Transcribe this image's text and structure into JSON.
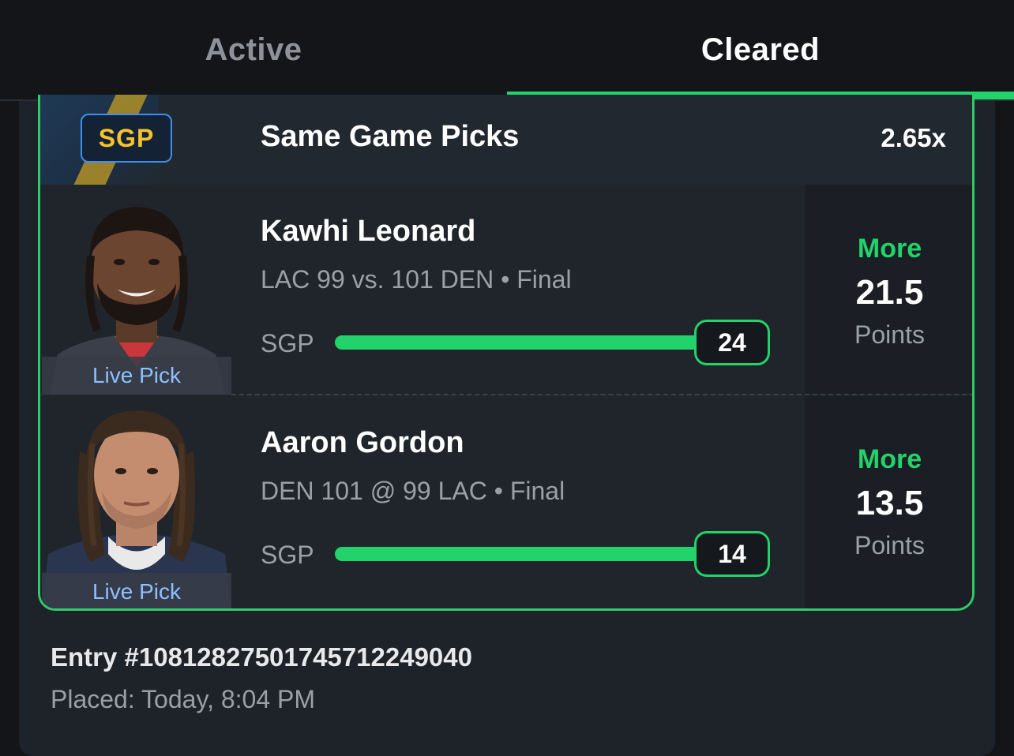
{
  "tabs": [
    {
      "label": "Active",
      "selected": false
    },
    {
      "label": "Cleared",
      "selected": true
    }
  ],
  "accent_color": "#22d26a",
  "card": {
    "badge": "SGP",
    "title": "Same Game Picks",
    "multiplier": "2.65x",
    "picks": [
      {
        "player": "Kawhi Leonard",
        "game": "LAC 99 vs. 101 DEN • Final",
        "tag": "Live Pick",
        "progress_label": "SGP",
        "progress_value": "24",
        "progress_fraction": 1.0,
        "direction": "More",
        "line": "21.5",
        "stat": "Points"
      },
      {
        "player": "Aaron Gordon",
        "game": "DEN 101 @ 99 LAC • Final",
        "tag": "Live Pick",
        "progress_label": "SGP",
        "progress_value": "14",
        "progress_fraction": 1.0,
        "direction": "More",
        "line": "13.5",
        "stat": "Points"
      }
    ]
  },
  "entry": {
    "id": "Entry #1081282750174571224904​0",
    "placed": "Placed: Today, 8:04 PM"
  }
}
